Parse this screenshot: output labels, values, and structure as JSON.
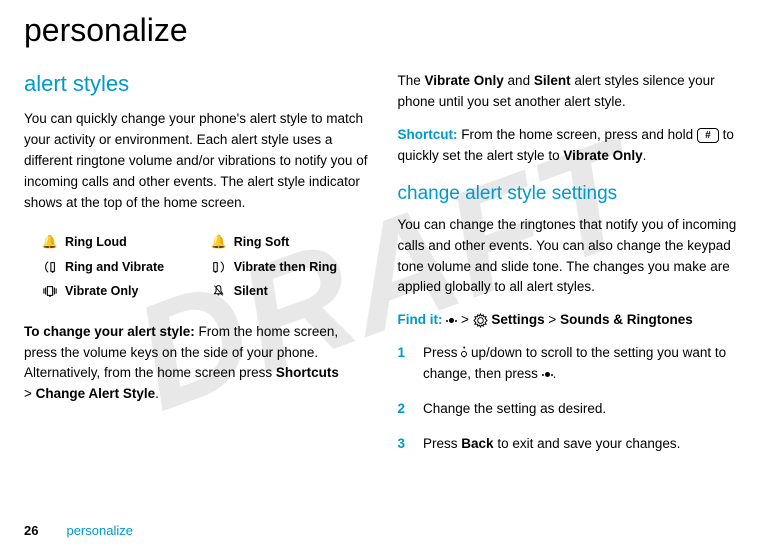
{
  "watermark": "DRAFT",
  "title": "personalize",
  "left": {
    "heading": "alert styles",
    "intro": "You can quickly change your phone's alert style to match your activity or environment. Each alert style uses a different ringtone volume and/or vibrations to notify you of incoming calls and other events. The alert style indicator shows at the top of the home screen.",
    "styles": [
      {
        "icon": "bell-icon",
        "label": "Ring Loud"
      },
      {
        "icon": "bell-icon",
        "label": "Ring Soft"
      },
      {
        "icon": "ring-vibrate-icon",
        "label": "Ring and Vibrate"
      },
      {
        "icon": "vibrate-ring-icon",
        "label": "Vibrate then Ring"
      },
      {
        "icon": "vibrate-only-icon",
        "label": "Vibrate Only"
      },
      {
        "icon": "silent-icon",
        "label": "Silent"
      }
    ],
    "change_bold": "To change your alert style:",
    "change_text": " From the home screen, press the volume keys on the side of your phone. Alternatively, from the home screen press ",
    "shortcuts_label": "Shortcuts",
    "gt1": " > ",
    "change_alert_style": "Change Alert Style",
    "period": "."
  },
  "right": {
    "para1_pre": "The ",
    "vibrate_only": "Vibrate Only",
    "para1_mid": " and ",
    "silent": "Silent",
    "para1_post": " alert styles silence your phone until you set another alert style.",
    "shortcut_label": "Shortcut:",
    "shortcut_pre": " From the home screen, press and hold ",
    "shortcut_post": " to quickly set the alert style to ",
    "shortcut_post2": ".",
    "heading2": "change alert style settings",
    "para2": "You can change the ringtones that notify you of incoming calls and other events. You can also change the keypad tone volume and slide tone. The changes you make are applied globally to all alert styles.",
    "find_it_label": "Find it:",
    "find_gt1": " > ",
    "find_settings": "Settings",
    "find_gt2": " > ",
    "find_sounds": "Sounds & Ringtones",
    "steps": [
      {
        "num": "1",
        "pre": "Press ",
        "mid": " up/down to scroll to the setting you want to change, then press ",
        "post": "."
      },
      {
        "num": "2",
        "text": "Change the setting as desired."
      },
      {
        "num": "3",
        "pre": "Press ",
        "back": "Back",
        "post": " to exit and save your changes."
      }
    ]
  },
  "footer": {
    "page": "26",
    "section": "personalize"
  }
}
